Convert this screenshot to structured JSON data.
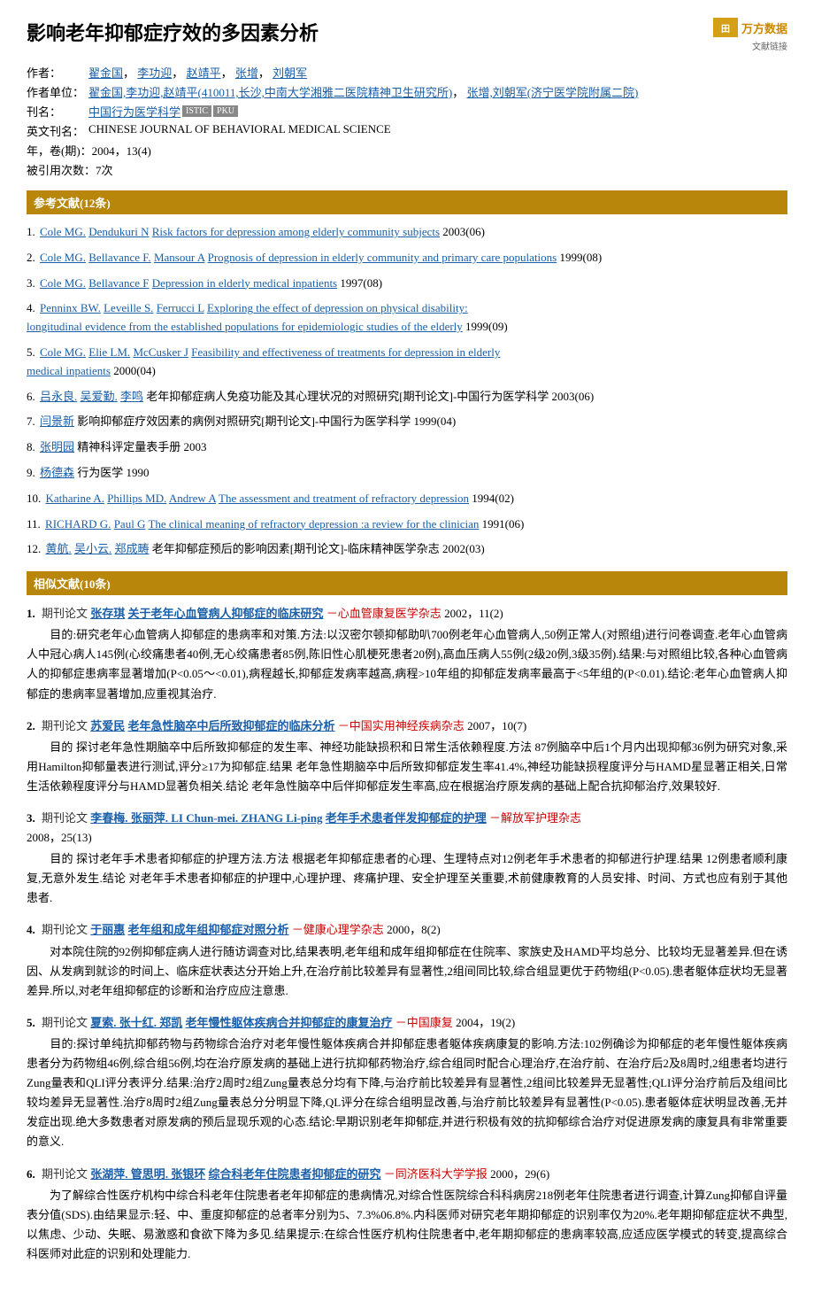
{
  "header": {
    "title": "影响老年抑郁症疗效的多因素分析",
    "logo_text": "万方数据",
    "logo_sub": "文献链接",
    "logo_icon": "田"
  },
  "meta": {
    "author_label": "作者：",
    "author_value": "翟金国,  李功迎,  赵靖平,  张增,  刘朝军",
    "affiliation_label": "作者单位：",
    "affiliation_value": "翟金国,李功迎,赵靖平(410011,长沙,中南大学湘雅二医院精神卫生研究所),  张增,刘朝军(济宁医学院附属二院)",
    "journal_label": "刊名：",
    "journal_value": "中国行为医学科学",
    "badges": [
      "ISTIC",
      "PKU"
    ],
    "english_label": "英文刊名：",
    "english_value": "CHINESE JOURNAL OF BEHAVIORAL MEDICAL SCIENCE",
    "year_label": "年，卷(期)：",
    "year_value": "2004，13(4)",
    "citations_label": "被引用次数：",
    "citations_value": "7次"
  },
  "reference_section": {
    "title": "参考文献(12条)",
    "items": [
      {
        "num": "1.",
        "authors": [
          "Cole MG.",
          "Dendukuri N"
        ],
        "title": "Risk factors for depression among elderly community subjects",
        "year": "2003(06)"
      },
      {
        "num": "2.",
        "authors": [
          "Cole MG.",
          "Bellavance F.",
          "Mansour A"
        ],
        "title": "Prognosis of depression in elderly community and primary care populations",
        "year": "1999(08)"
      },
      {
        "num": "3.",
        "authors": [
          "Cole MG.",
          "Bellavance F"
        ],
        "title": "Depression in elderly medical inpatients",
        "year": "1997(08)"
      },
      {
        "num": "4.",
        "authors": [
          "Penninx BW.",
          "Leveille S.",
          "Ferrucci L"
        ],
        "title": "Exploring the effect of depression on physical disability: longitudinal evidence from the established populations for epidemiologic studies of the elderly",
        "year": "1999(09)"
      },
      {
        "num": "5.",
        "authors": [
          "Cole MG.",
          "Elie LM.",
          "McCusker J"
        ],
        "title": "Feasibility and effectiveness of treatments for depression in elderly medical inpatients",
        "year": "2000(04)"
      },
      {
        "num": "6.",
        "authors": [
          "吕永良.",
          "吴爱勤.",
          "李鸣"
        ],
        "title": "老年抑郁症病人免疫功能及其心理状况的对照研究[期刊论文]-中国行为医学科学",
        "year": "2003(06)"
      },
      {
        "num": "7.",
        "authors": [
          "闫景新"
        ],
        "title": "影响抑郁症疗效因素的病例对照研究[期刊论文]-中国行为医学科学",
        "year": "1999(04)"
      },
      {
        "num": "8.",
        "authors": [
          "张明园"
        ],
        "title": "精神科评定量表手册",
        "year": "2003"
      },
      {
        "num": "9.",
        "authors": [
          "杨德森"
        ],
        "title": "行为医学",
        "year": "1990"
      },
      {
        "num": "10.",
        "authors": [
          "Katharine A.",
          "Phillips MD.",
          "Andrew A"
        ],
        "title": "The assessment and treatment of refractory depression",
        "year": "1994(02)"
      },
      {
        "num": "11.",
        "authors": [
          "RICHARD G.",
          "Paul G"
        ],
        "title": "The clinical meaning of refractory depression :a review for the clinician",
        "year": "1991(06)"
      },
      {
        "num": "12.",
        "authors": [
          "黄航.",
          "吴小云.",
          "郑成畴"
        ],
        "title": "老年抑郁症预后的影响因素[期刊论文]-临床精神医学杂志",
        "year": "2002(03)"
      }
    ]
  },
  "related_section": {
    "title": "相似文献(10条)",
    "items": [
      {
        "num": "1.",
        "type": "期刊论文",
        "author": "张存琪",
        "title": "关于老年心血管病人抑郁症的临床研究",
        "journal": "－心血管康复医学杂志",
        "year": "2002，11(2)",
        "desc": "目的:研究老年心血管病人抑郁症的患病率和对策.方法:以汉密尔顿抑郁助叭700例老年心血管病人,50例正常人(对照组)进行问卷调查.老年心血管病人中冠心病人145例(心绞痛患者40例,无心绞痛患者85例,陈旧性心肌梗死患者20例),高血压病人55例(2级20例,3级35例).结果:与对照组比较,各种心血管病人的抑郁症患病率显著增加(P<0.05～<0.01),病程越长,抑郁症发病率越高,病程>10年组的抑郁症发病率最高于<5年组的(P<0.01).结论:老年心血管病人抑郁症的患病率显著增加,应重视其治疗."
      },
      {
        "num": "2.",
        "type": "期刊论文",
        "author": "苏爱民",
        "title": "老年急性脑卒中后所致抑郁症的临床分析",
        "journal": "－中国实用神经疾病杂志",
        "year": "2007，10(7)",
        "desc": "目的 探讨老年急性期脑卒中后所致抑郁症的发生率、神经功能缺损积和日常生活依赖程度.方法 87例脑卒中后1个月内出现抑郁36例为研究对象,采用Hamilton抑郁量表进行测试,评分≥17为抑郁症.结果 老年急性期脑卒中后所致抑郁症发生率41.4%,神经功能缺损程度评分与HAMD星显著正相关,日常生活依赖程度评分与HAMD显著负相关.结论 老年急性脑卒中后伴抑郁症发生率高,应在根据治疗原发病的基础上配合抗抑郁治疗,效果较好."
      },
      {
        "num": "3.",
        "type": "期刊论文",
        "author": "李春梅. 张丽萍. LI Chun-mei. ZHANG Li-ping",
        "title": "老年手术患者伴发抑郁症的护理",
        "journal": "－解放军护理杂志",
        "year": "2008，25(13)",
        "desc": "目的 探讨老年手术患者抑郁症的护理方法.方法 根据老年抑郁症患者的心理、生理特点对12例老年手术患者的抑郁进行护理.结果 12例患者顺利康复,无意外发生.结论 对老年手术患者抑郁症的护理中,心理护理、疼痛护理、安全护理至关重要,术前健康教育的人员安排、时间、方式也应有别于其他患者."
      },
      {
        "num": "4.",
        "type": "期刊论文",
        "author": "于丽惠",
        "title": "老年组和成年组抑郁症对照分析",
        "journal": "－健康心理学杂志",
        "year": "2000，8(2)",
        "desc": "对本院住院的92例抑郁症病人进行随访调查对比,结果表明,老年组和成年组抑郁症在住院率、家族史及HAMD平均总分、比较均无显著差异.但在诱因、从发病到就诊的时间上、临床症状表达分开始上升,在治疗前比较差异有显著性,2组间同比较,综合组显更优于药物组(P<0.05).患者躯体症状均无显著差异.所以,对老年组抑郁症的诊断和治疗应应注意患."
      },
      {
        "num": "5.",
        "type": "期刊论文",
        "author": "夏索. 张十红. 郑凯",
        "title": "老年慢性躯体疾病合并抑郁症的康复治疗",
        "journal": "－中国康复",
        "year": "2004，19(2)",
        "desc": "目的:探讨单纯抗抑郁药物与药物综合治疗对老年慢性躯体疾病合并抑郁症患者躯体疾病康复的影响.方法:102例确诊为抑郁症的老年慢性躯体疾病患者分为药物组46例,综合组56例,均在治疗原发病的基础上进行抗抑郁药物治疗,综合组同时配合心理治疗,在治疗前、在治疗后2及8周时,2组患者均进行Zung量表和QLI评分表评分.结果:治疗2周时2组Zung量表总分均有下降,与治疗前比较差异有显著性,2组间比较差异无显著性;QLI评分治疗前后及组间比较均差异无显著性.治疗8周时2组Zung量表总分分明显下降,QL评分在综合组明显改善,与治疗前比较差异有显著性(P<0.05).患者躯体症状明显改善,无并发症出现.绝大多数患者对原发病的预后显现乐观的心态.结论:早期识别老年抑郁症,并进行积极有效的抗抑郁综合治疗对促进原发病的康复具有非常重要的意义."
      },
      {
        "num": "6.",
        "type": "期刊论文",
        "author": "张湖萍. 管思明. 张银环",
        "title": "综合科老年住院患者抑郁症的研究",
        "journal": "－同济医科大学学报",
        "year": "2000，29(6)",
        "desc": "为了解综合性医疗机构中综合科老年住院患者老年抑郁症的患病情况,对综合性医院综合科科病房218例老年住院患者进行调查,计算Zung抑郁自评量表分值(SDS).由结果显示:轻、中、重度抑郁症的总者率分别为5、7.3%06.8%.内科医师对研究老年期抑郁症的识别率仅为20%.老年期抑郁症症状不典型,以焦虑、少动、失眠、易激惑和食欲下降为多见.结果提示:在综合性医疗机构住院患者中,老年期抑郁症的患病率较高,应适应医学模式的转变,提高综合科医师对此症的识别和处理能力."
      }
    ]
  }
}
